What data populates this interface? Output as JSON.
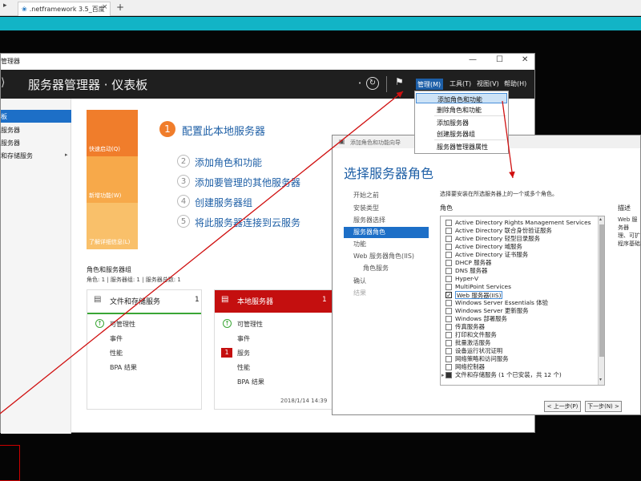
{
  "browser": {
    "tab_title": ".netframework 3.5_百度",
    "new_tab": "+",
    "close": "×"
  },
  "server_manager": {
    "window_title": "管理器",
    "header_title": "服务器管理器 · 仪表板",
    "menus": {
      "manage": "管理(M)",
      "tools": "工具(T)",
      "view": "视图(V)",
      "help": "帮助(H)"
    },
    "manage_menu": [
      "添加角色和功能",
      "删除角色和功能",
      "添加服务器",
      "创建服务器组",
      "服务器管理器属性"
    ],
    "sidebar": [
      "板",
      "服务器",
      "服务器",
      "和存储服务"
    ],
    "tiles": [
      "快速启动(Q)",
      "新增功能(W)",
      "了解详细信息(L)"
    ],
    "quickstart": [
      {
        "num": "1",
        "text": "配置此本地服务器"
      },
      {
        "num": "2",
        "text": "添加角色和功能"
      },
      {
        "num": "3",
        "text": "添加要管理的其他服务器"
      },
      {
        "num": "4",
        "text": "创建服务器组"
      },
      {
        "num": "5",
        "text": "将此服务器连接到云服务"
      }
    ],
    "roles_groups_title": "角色和服务器组",
    "roles_groups_sub": "角色: 1 | 服务器组: 1 | 服务器总数: 1",
    "card_file": {
      "title": "文件和存储服务",
      "count": "1",
      "rows": [
        "可管理性",
        "事件",
        "性能",
        "BPA 结果"
      ]
    },
    "card_local": {
      "title": "本地服务器",
      "count": "1",
      "rows": [
        "可管理性",
        "事件",
        "服务",
        "性能",
        "BPA 结果"
      ],
      "badge": "1",
      "timestamp": "2018/1/14 14:39"
    }
  },
  "wizard": {
    "window_title": "添加角色和功能向导",
    "heading": "选择服务器角色",
    "nav": [
      "开始之前",
      "安装类型",
      "服务器选择",
      "服务器角色",
      "功能",
      "Web 服务器角色(IIS)",
      "角色服务",
      "确认",
      "结果"
    ],
    "description": "选择要安装在所选服务器上的一个或多个角色。",
    "roles_header": "角色",
    "desc_header": "描述",
    "desc_text": "Web 服务器 理、可扩 程序基础",
    "roles": [
      "Active Directory Rights Management Services",
      "Active Directory 联合身份验证服务",
      "Active Directory 轻型目录服务",
      "Active Directory 域服务",
      "Active Directory 证书服务",
      "DHCP 服务器",
      "DNS 服务器",
      "Hyper-V",
      "MultiPoint Services",
      "Web 服务器(IIS)",
      "Windows Server Essentials 体验",
      "Windows Server 更新服务",
      "Windows 部署服务",
      "传真服务器",
      "打印和文件服务",
      "批量激活服务",
      "设备运行状况证明",
      "网络策略和访问服务",
      "网络控制器",
      "文件和存储服务 (1 个已安装，共 12 个)"
    ],
    "buttons": {
      "prev": "< 上一步(P)",
      "next": "下一步(N) >"
    }
  },
  "colors": {
    "accent_blue": "#1d6fc7",
    "teal_bar": "#12b4c6",
    "orange_tile": "#f07d2b",
    "red_header": "#c40f0f",
    "green_line": "#3aa635"
  }
}
